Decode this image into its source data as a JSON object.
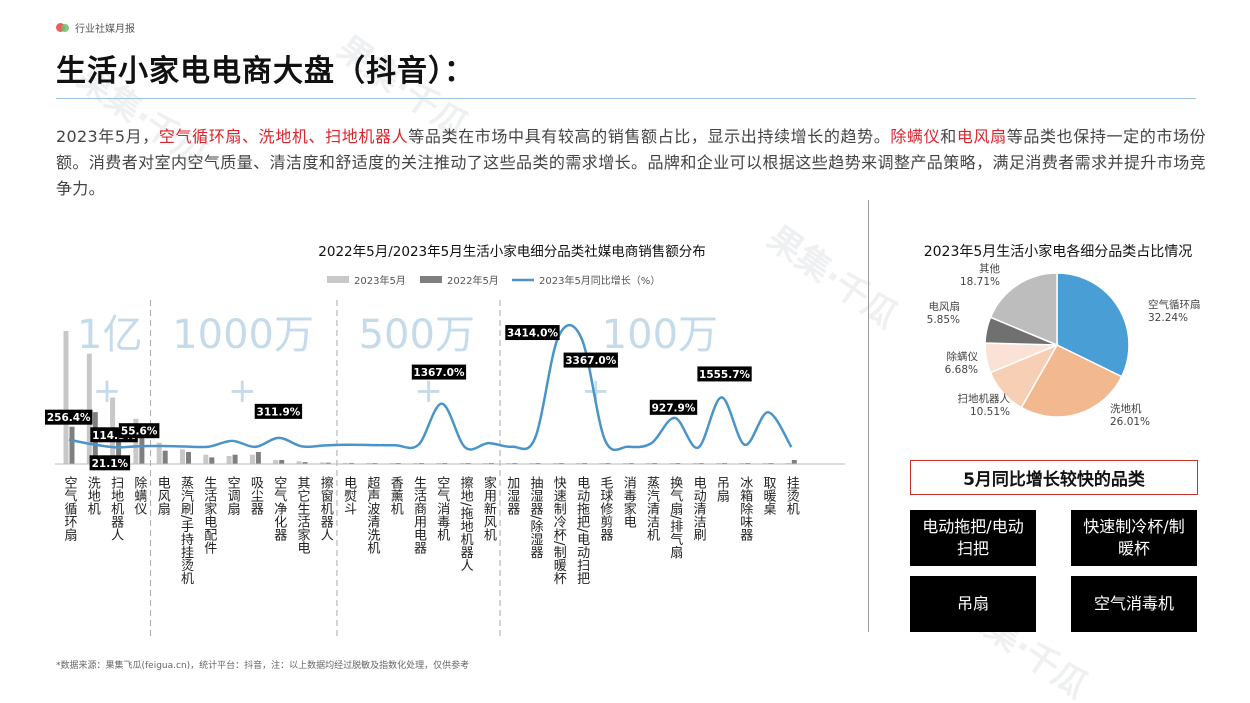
{
  "header": {
    "brand": "行业社媒月报",
    "title": "生活小家电电商大盘（抖音）：",
    "intro": [
      {
        "t": "2023年5月，",
        "hl": false
      },
      {
        "t": "空气循环扇、洗地机、扫地机器人",
        "hl": true
      },
      {
        "t": "等品类在市场中具有较高的销售额占比，显示出持续增长的趋势。",
        "hl": false
      },
      {
        "t": "除螨仪",
        "hl": true
      },
      {
        "t": "和",
        "hl": false
      },
      {
        "t": "电风扇",
        "hl": true
      },
      {
        "t": "等品类也保持一定的市场份额。消费者对室内空气质量、清洁度和舒适度的关注推动了这些品类的需求增长。品牌和企业可以根据这些趋势来调整产品策略，满足消费者需求并提升市场竞争力。",
        "hl": false
      }
    ]
  },
  "colors": {
    "bar_2023": "#c8c8c8",
    "bar_2022": "#7f7f7f",
    "line": "#4a94c8",
    "highlight": "#d8262c",
    "tier_label": "#c5dbea",
    "pie": [
      "#4a9ed6",
      "#f2b88f",
      "#f6cfb5",
      "#fae3d6",
      "#707070",
      "#bdbdbd"
    ]
  },
  "chart_data": [
    {
      "type": "bar",
      "title": "2022年5月/2023年5月生活小家电细分品类社媒电商销售额分布",
      "legend": [
        "2023年5月",
        "2022年5月",
        "2023年5月同比增长（%）"
      ],
      "legend_position": "top-center",
      "tiers": [
        "1亿+",
        "1000万+",
        "500万+",
        "100万+"
      ],
      "tier_ranges": [
        [
          0,
          3
        ],
        [
          4,
          11
        ],
        [
          12,
          18
        ],
        [
          19,
          31
        ]
      ],
      "categories": [
        "空气循环扇",
        "洗地机",
        "扫地机器人",
        "除螨仪",
        "电风扇",
        "蒸汽刷/手持挂烫机",
        "生活家电配件",
        "空调扇",
        "吸尘器",
        "空气净化器",
        "其它生活家电",
        "擦窗机器人",
        "电熨斗",
        "超声波清洗机",
        "香薰机",
        "生活商用电器",
        "空气消毒机",
        "擦地/拖地机器人",
        "家用新风机",
        "加湿器",
        "抽湿器/除湿器",
        "快速制冷杯/制暖杯",
        "电动拖把/电动扫把",
        "毛球修剪器",
        "消毒家电",
        "蒸汽清洁机",
        "换气扇/排气扇",
        "电动清洁刷",
        "吊扇",
        "冰箱除味器",
        "取暖桌",
        "挂烫机"
      ],
      "series": [
        {
          "name": "2023年5月",
          "values": [
            100,
            83,
            50,
            34,
            16,
            11,
            7,
            6,
            7,
            3,
            2,
            1.2,
            0.8,
            0.8,
            0.7,
            0.7,
            0.6,
            0.6,
            0.5,
            0.3,
            0.3,
            0.3,
            0.3,
            0.2,
            0.2,
            0.2,
            0.2,
            0.2,
            0.2,
            0.2,
            0.2,
            0.2
          ]
        },
        {
          "name": "2022年5月",
          "values": [
            28,
            39,
            24,
            22,
            10,
            9,
            5,
            7,
            9,
            3,
            1.4,
            1,
            0.8,
            0.6,
            0.5,
            0.3,
            0.2,
            0.5,
            0.4,
            0.2,
            0.2,
            0.1,
            0.1,
            0.2,
            0.2,
            0.2,
            0.1,
            0.2,
            0.1,
            0.1,
            0.1,
            3
          ]
        },
        {
          "name": "2023年5月同比增长（%）",
          "values": [
            256.4,
            114.5,
            21.1,
            55.6,
            60,
            45,
            40,
            220,
            35,
            311.9,
            50,
            80,
            100,
            90,
            85,
            100,
            1367.0,
            20,
            150,
            40,
            300,
            3414.0,
            3367.0,
            250,
            40,
            150,
            927.9,
            10,
            1555.7,
            100,
            1100,
            30
          ]
        }
      ],
      "data_labels": [
        {
          "index": 0,
          "text": "256.4%"
        },
        {
          "index": 1,
          "text": "114.5%"
        },
        {
          "index": 2,
          "text": "21.1%"
        },
        {
          "index": 3,
          "text": "55.6%"
        },
        {
          "index": 9,
          "text": "311.9%"
        },
        {
          "index": 16,
          "text": "1367.0%"
        },
        {
          "index": 21,
          "text": "3414.0%"
        },
        {
          "index": 22,
          "text": "3367.0%"
        },
        {
          "index": 26,
          "text": "927.9%"
        },
        {
          "index": 28,
          "text": "1555.7%"
        }
      ],
      "ylim_bars": [
        0,
        100
      ],
      "ylim_line": [
        0,
        3600
      ],
      "grid": false
    },
    {
      "type": "pie",
      "title": "2023年5月生活小家电各细分品类占比情况",
      "slices": [
        {
          "label": "空气循环扇",
          "value": 32.24,
          "value_text": "32.24%"
        },
        {
          "label": "洗地机",
          "value": 26.01,
          "value_text": "26.01%"
        },
        {
          "label": "扫地机器人",
          "value": 10.51,
          "value_text": "10.51%"
        },
        {
          "label": "除螨仪",
          "value": 6.68,
          "value_text": "6.68%"
        },
        {
          "label": "电风扇",
          "value": 5.85,
          "value_text": "5.85%"
        },
        {
          "label": "其他",
          "value": 18.71,
          "value_text": "18.71%"
        }
      ]
    }
  ],
  "fast_growth": {
    "title": "5月同比增长较快的品类",
    "items": [
      "电动拖把/电动扫把",
      "快速制冷杯/制暖杯",
      "吊扇",
      "空气消毒机"
    ]
  },
  "footer": {
    "note": "*数据来源：果集飞瓜(feigua.cn)，统计平台：抖音，注：以上数据均经过脱敏及指数化处理，仅供参考"
  },
  "watermark": "果集·千瓜"
}
